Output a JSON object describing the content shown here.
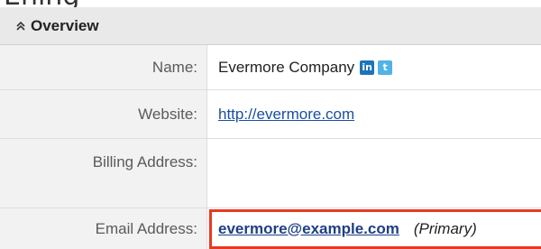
{
  "top_clipped_text": "Ening",
  "panel": {
    "title": "Overview"
  },
  "fields": {
    "name": {
      "label": "Name:",
      "value": "Evermore Company",
      "social": {
        "linkedin": "in",
        "twitter": "t"
      }
    },
    "website": {
      "label": "Website:",
      "value": "http://evermore.com"
    },
    "billing": {
      "label": "Billing Address:",
      "value": ""
    },
    "email": {
      "label": "Email Address:",
      "value": "evermore@example.com",
      "tag": "(Primary)"
    }
  },
  "colors": {
    "highlight_border": "#e8391f",
    "link": "#1a4fa0"
  }
}
